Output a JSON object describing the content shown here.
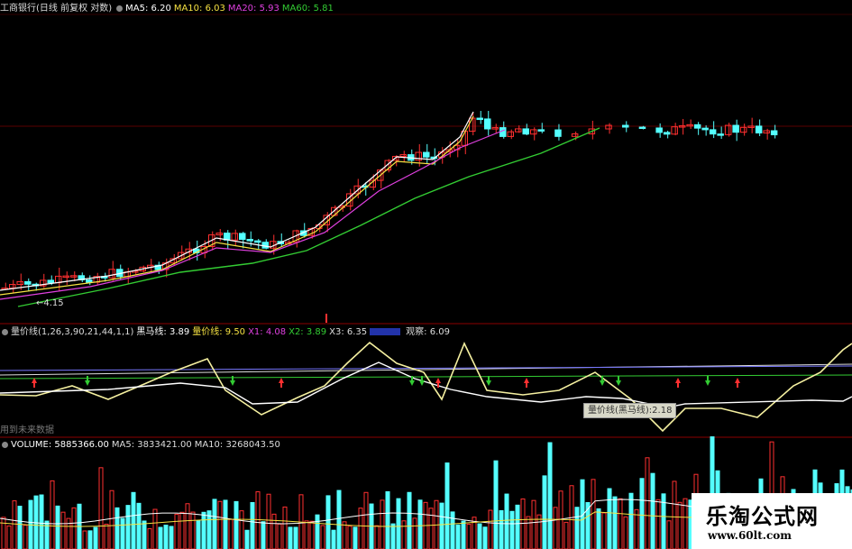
{
  "price_panel": {
    "title": "工商银行(日线 前复权 对数)",
    "ma5": "MA5: 6.20",
    "ma10": "MA10: 6.03",
    "ma20": "MA20: 5.93",
    "ma60": "MA60: 5.81",
    "low_marker": "←4.15"
  },
  "indicator_panel": {
    "title": "量价线(1,26,3,90,21,44,1,1)",
    "heima": "黑马线: 3.89",
    "liangjia": "量价线: 9.50",
    "x1": "X1: 4.08",
    "x2": "X2: 3.89",
    "x3": "X3: 6.35",
    "guancha": "观察: 6.09",
    "future_note": "用到未来数据",
    "tooltip": "量价线(黑马线):2.18"
  },
  "volume_panel": {
    "volume": "VOLUME: 5885366.00",
    "ma5": "MA5: 3833421.00",
    "ma10": "MA10: 3268043.50"
  },
  "watermark": {
    "title": "乐淘公式网",
    "url": "www.60lt.com"
  },
  "colors": {
    "background": "#000000",
    "up": "#ff3030",
    "down": "#54ffff",
    "ma5": "#ffffff",
    "ma10": "#f5e142",
    "ma20": "#e040e0",
    "ma60": "#33cc33",
    "separator": "#8b0000"
  }
}
